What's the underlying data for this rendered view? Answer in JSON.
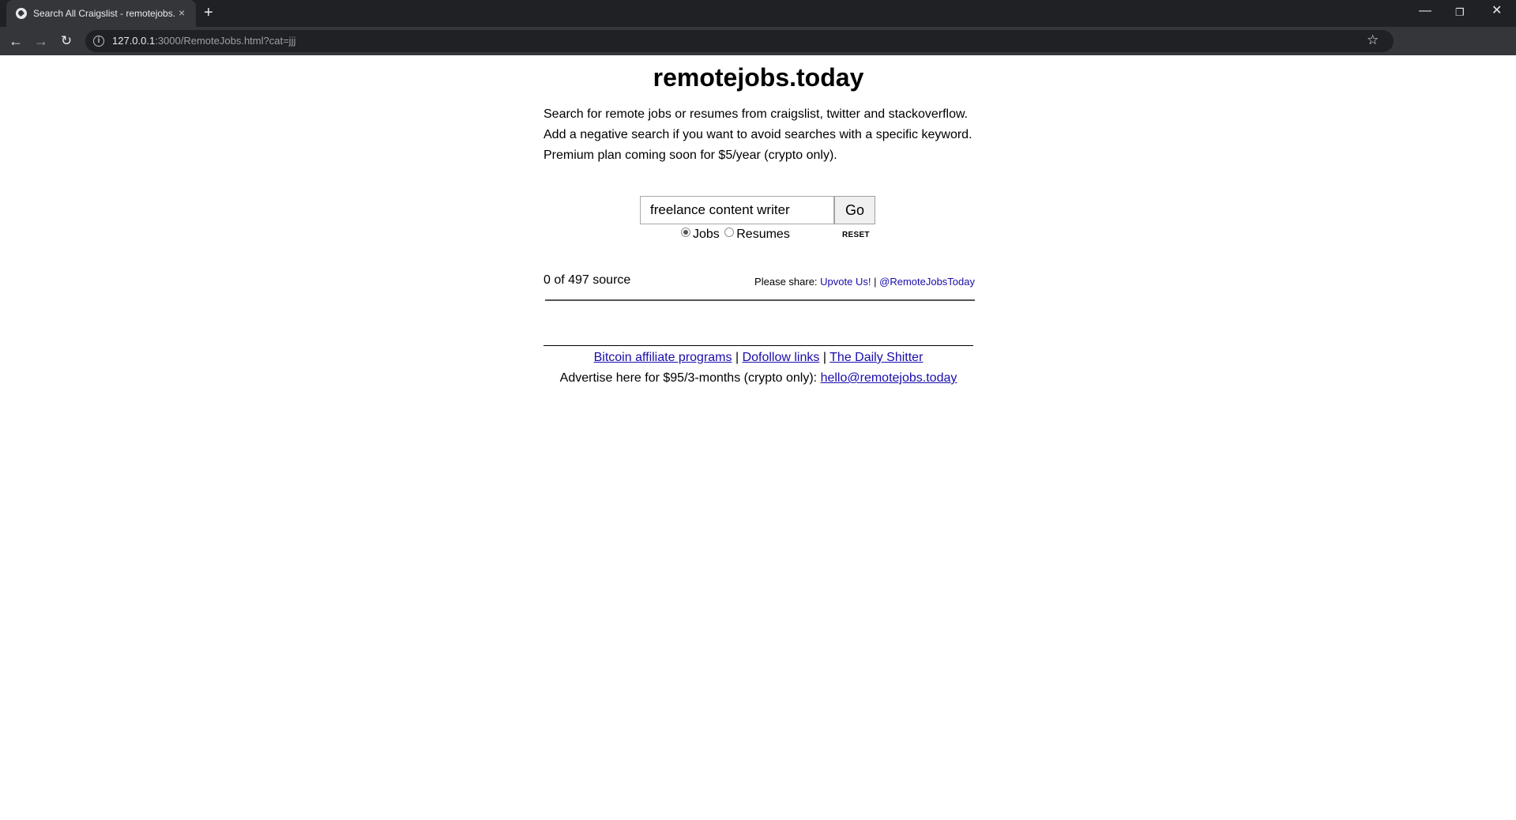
{
  "browser": {
    "tab_title": "Search All Craigslist - remotejobs.today",
    "tab_close": "×",
    "new_tab": "+",
    "url_host": "127.0.0.1",
    "url_rest": ":3000/RemoteJobs.html?cat=jjj",
    "icons": {
      "back": "arrow-left-icon",
      "forward": "arrow-right-icon",
      "reload": "reload-icon",
      "info": "info-icon",
      "star": "star-icon",
      "minimize": "minimize-icon",
      "maximize": "restore-icon",
      "close": "close-icon"
    }
  },
  "page": {
    "title": "remotejobs.today",
    "intro_lines": [
      "Search for remote jobs or resumes from craigslist, twitter and stackoverflow.",
      "Add a negative search if you want to avoid searches with a specific keyword.",
      "Premium plan coming soon for $5/year (crypto only)."
    ],
    "search": {
      "value": "freelance content writer",
      "go_label": "Go"
    },
    "radios": [
      {
        "label": "Jobs",
        "checked": true
      },
      {
        "label": "Resumes",
        "checked": false
      }
    ],
    "reset_label": "RESET",
    "source_count": "0 of 497 source",
    "share": {
      "prefix": "Please share:",
      "upvote": "Upvote Us!",
      "separator": "|",
      "twitter": "@RemoteJobsToday"
    },
    "footer": {
      "links": [
        "Bitcoin affiliate programs",
        "Dofollow links",
        "The Daily Shitter"
      ],
      "separator": "|",
      "advertise_text": "Advertise here for $95/3-months (crypto only):",
      "email": "hello@remotejobs.today"
    }
  },
  "colors": {
    "chrome_dark": "#202124",
    "chrome_toolbar": "#35363a",
    "link": "#1a0dab"
  }
}
